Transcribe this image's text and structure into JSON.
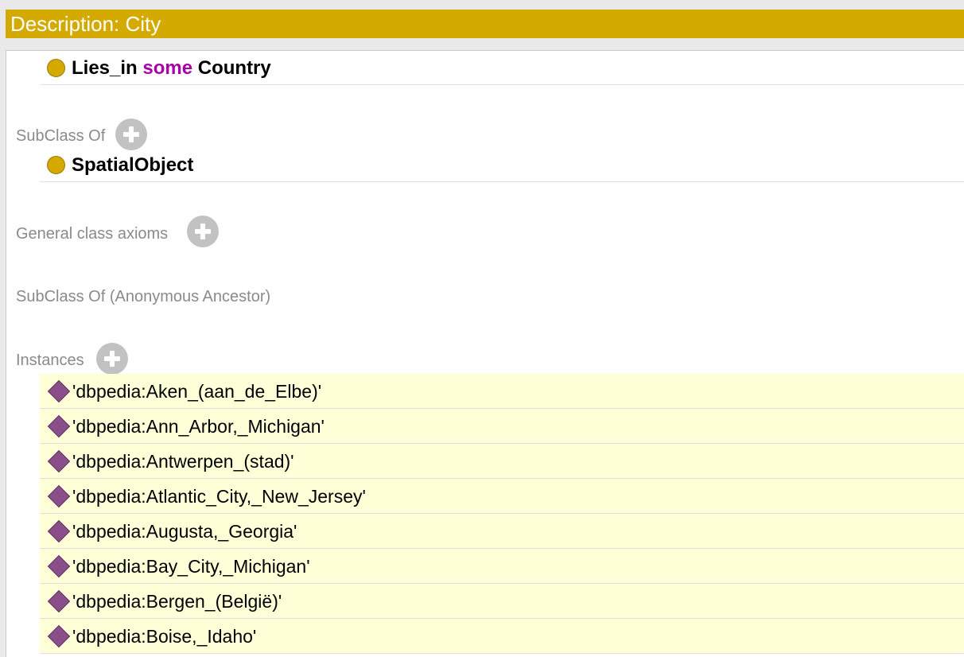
{
  "header": {
    "title": "Description: City"
  },
  "equivalent_to": {
    "axiom": {
      "property": "Lies_in",
      "keyword": "some",
      "filler": "Country"
    }
  },
  "sections": {
    "subclass_of": {
      "label": "SubClass Of",
      "items": [
        "SpatialObject"
      ]
    },
    "general_class_axioms": {
      "label": "General class axioms"
    },
    "subclass_of_anonymous": {
      "label": "SubClass Of (Anonymous Ancestor)"
    },
    "instances": {
      "label": "Instances",
      "items": [
        "'dbpedia:Aken_(aan_de_Elbe)'",
        "'dbpedia:Ann_Arbor,_Michigan'",
        "'dbpedia:Antwerpen_(stad)'",
        "'dbpedia:Atlantic_City,_New_Jersey'",
        "'dbpedia:Augusta,_Georgia'",
        "'dbpedia:Bay_City,_Michigan'",
        "'dbpedia:Bergen_(België)'",
        "'dbpedia:Boise,_Idaho'"
      ]
    }
  },
  "icons": {
    "class": "class-circle-icon",
    "individual": "individual-diamond-icon",
    "add": "add-icon"
  },
  "colors": {
    "header_bg": "#d4a900",
    "class_icon": "#d4a900",
    "individual_icon": "#8a4f8a",
    "keyword": "#a800a8",
    "instance_row_bg": "#ffffd8"
  }
}
